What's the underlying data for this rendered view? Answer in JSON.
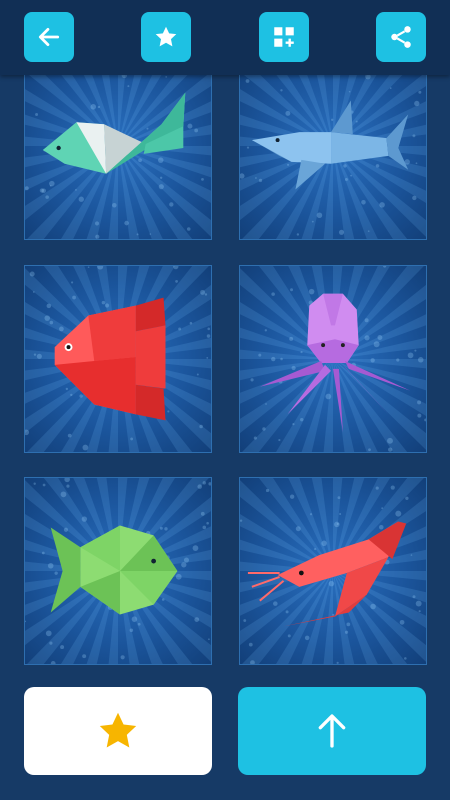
{
  "toolbar": {
    "buttons": [
      {
        "name": "back-button",
        "icon": "arrow-left-icon"
      },
      {
        "name": "favorites-button",
        "icon": "star-icon"
      },
      {
        "name": "add-widget-button",
        "icon": "grid-plus-icon"
      },
      {
        "name": "share-button",
        "icon": "share-icon"
      }
    ],
    "accent_color": "#1ec1e3",
    "bar_color": "#112f55"
  },
  "gallery": {
    "items": [
      {
        "subject": "origami-whale",
        "color": "#5fd4b4"
      },
      {
        "subject": "origami-shark",
        "color": "#7cb6e6"
      },
      {
        "subject": "origami-sunfish",
        "color": "#ef3c3c"
      },
      {
        "subject": "origami-octopus",
        "color": "#b66be0"
      },
      {
        "subject": "origami-fish",
        "color": "#7ed466"
      },
      {
        "subject": "origami-shrimp",
        "color": "#f04848"
      }
    ]
  },
  "bottom_bar": {
    "favorite_icon": "star-icon",
    "favorite_icon_color": "#f7b500",
    "scroll_top_icon": "arrow-up-icon"
  }
}
